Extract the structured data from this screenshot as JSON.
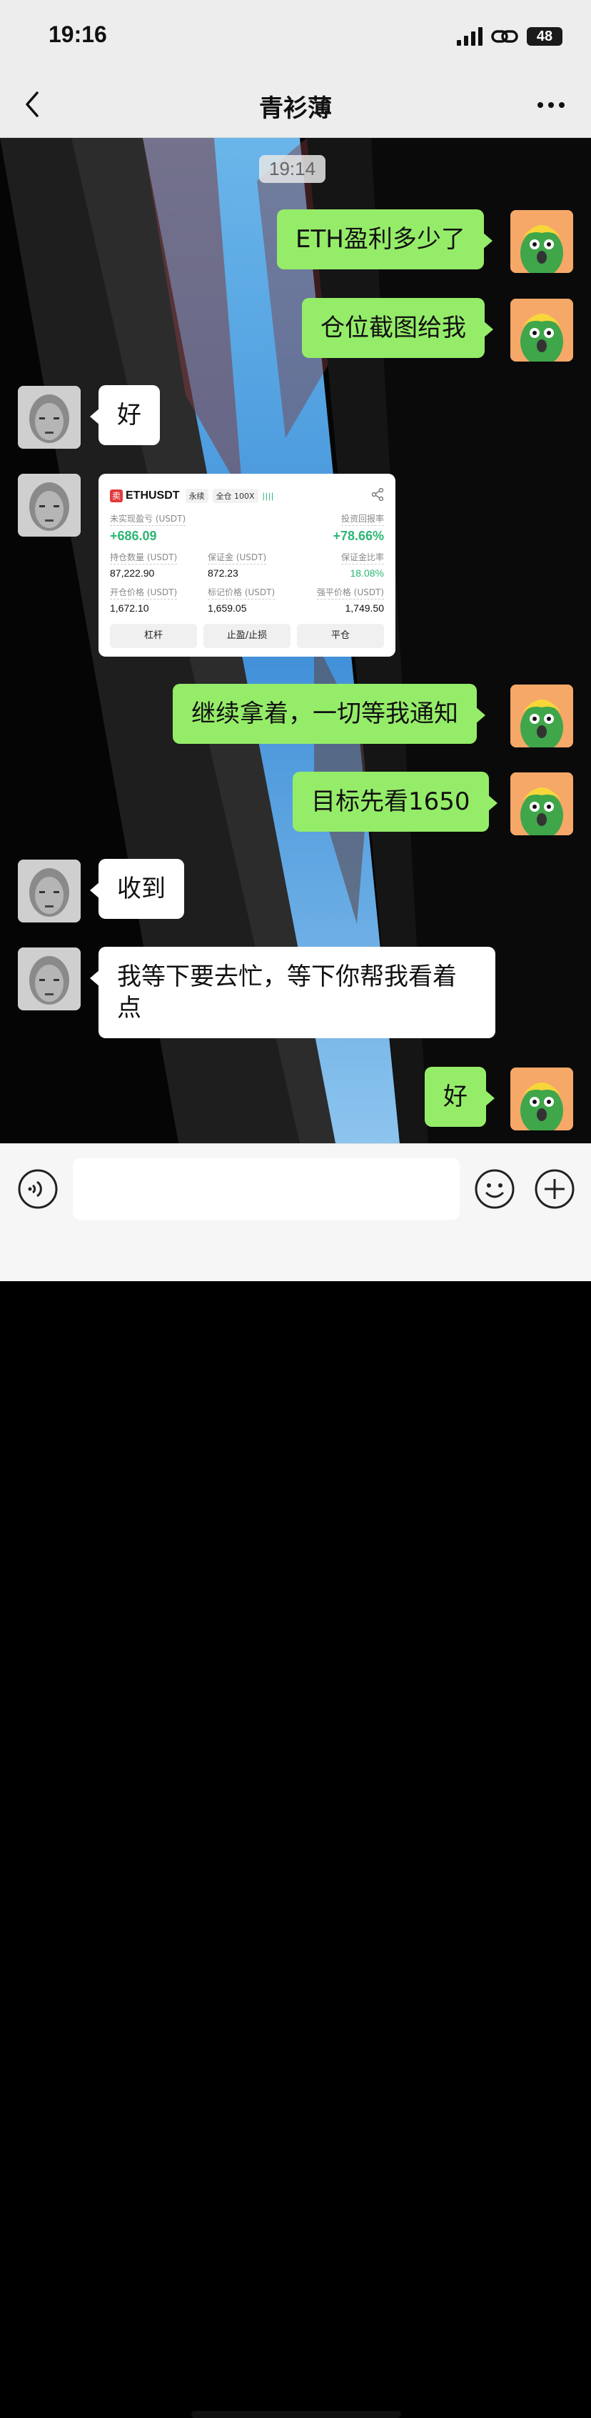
{
  "status": {
    "time": "19:16",
    "battery": "48"
  },
  "nav": {
    "title": "青衫薄"
  },
  "chat": {
    "timestamp": "19:14",
    "messages": [
      {
        "from": "me",
        "text": "ETH盈利多少了"
      },
      {
        "from": "me",
        "text": "仓位截图给我"
      },
      {
        "from": "them",
        "text": "好"
      },
      {
        "from": "them",
        "type": "image"
      },
      {
        "from": "me",
        "text": "继续拿着，一切等我通知"
      },
      {
        "from": "me",
        "text": "目标先看1650"
      },
      {
        "from": "them",
        "text": "收到"
      },
      {
        "from": "them",
        "text": "我等下要去忙，等下你帮我看着点"
      },
      {
        "from": "me",
        "text": "好"
      }
    ]
  },
  "card": {
    "badge": "卖",
    "symbol": "ETHUSDT",
    "tag1": "永续",
    "tag2": "全仓 100X",
    "bars": "||||",
    "pnl_label": "未实现盈亏 (USDT)",
    "pnl_value": "+686.09",
    "roi_label": "投资回报率",
    "roi_value": "+78.66%",
    "qty_label": "持仓数量 (USDT)",
    "qty_value": "87,222.90",
    "margin_label": "保证金 (USDT)",
    "margin_value": "872.23",
    "margin_ratio_label": "保证金比率",
    "margin_ratio_value": "18.08%",
    "open_label": "开仓价格 (USDT)",
    "open_value": "1,672.10",
    "mark_label": "标记价格 (USDT)",
    "mark_value": "1,659.05",
    "liq_label": "强平价格 (USDT)",
    "liq_value": "1,749.50",
    "btn_leverage": "杠杆",
    "btn_tpsl": "止盈/止损",
    "btn_close": "平仓"
  },
  "colors": {
    "me_bubble": "#95ec69",
    "green": "#2bb673",
    "sell": "#e23b3b"
  }
}
